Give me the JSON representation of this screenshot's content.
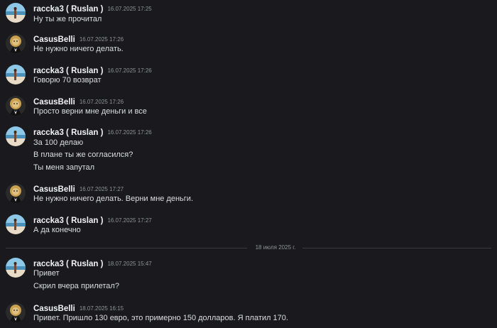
{
  "divider": {
    "date_label": "18 июля 2025 г."
  },
  "messages": [
    {
      "author": "raccka3 ( Ruslan )",
      "time": "16.07.2025 17:25",
      "lines": [
        "Ну ты же прочитал"
      ]
    },
    {
      "author": "CasusBelli",
      "time": "16.07.2025 17:26",
      "lines": [
        "Не нужно ничего делать."
      ]
    },
    {
      "author": "raccka3 ( Ruslan )",
      "time": "16.07.2025 17:26",
      "lines": [
        "Говорю 70 возврат"
      ]
    },
    {
      "author": "CasusBelli",
      "time": "16.07.2025 17:26",
      "lines": [
        "Просто верни мне деньги и все"
      ]
    },
    {
      "author": "raccka3 ( Ruslan )",
      "time": "16.07.2025 17:26",
      "lines": [
        "За 100 делаю",
        "В плане ты же согласился?",
        "Ты меня запутал"
      ]
    },
    {
      "author": "CasusBelli",
      "time": "16.07.2025 17:27",
      "lines": [
        "Не нужно ничего делать. Верни мне деньги."
      ]
    },
    {
      "author": "raccka3 ( Ruslan )",
      "time": "16.07.2025 17:27",
      "lines": [
        "А да конечно"
      ]
    },
    {
      "author": "raccka3 ( Ruslan )",
      "time": "18.07.2025 15:47",
      "lines": [
        "Привет",
        "Скрил вчера прилетал?"
      ]
    },
    {
      "author": "CasusBelli",
      "time": "18.07.2025 16:15",
      "lines": [
        "Привет. Пришло 130 евро, это примерно 150 долларов. Я платил 170."
      ]
    }
  ]
}
